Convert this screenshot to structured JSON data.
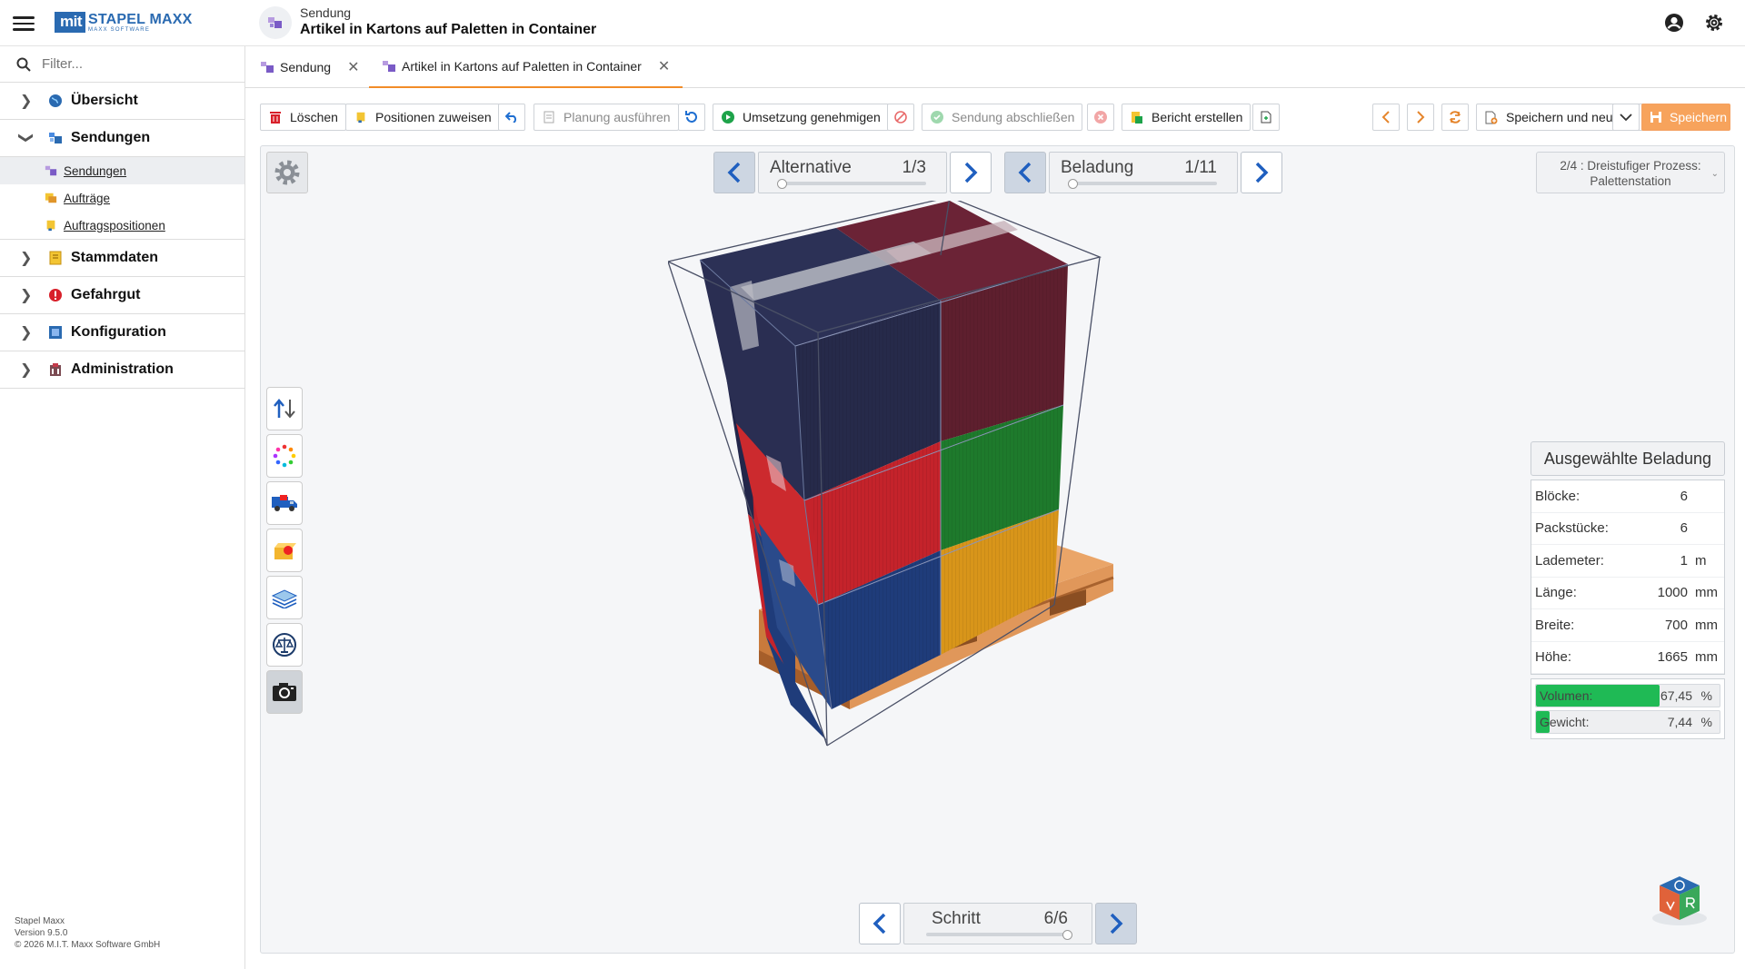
{
  "header": {
    "logo_box": "mit",
    "logo_main": "STAPEL MAXX",
    "logo_sub": "MAXX SOFTWARE",
    "kicker": "Sendung",
    "title": "Artikel in Kartons auf Paletten in Container",
    "icons": [
      "menu-icon",
      "user-icon",
      "gear-icon"
    ]
  },
  "sidebar": {
    "filter_placeholder": "Filter...",
    "items": [
      {
        "label": "Übersicht",
        "icon": "globe-icon",
        "expanded": false
      },
      {
        "label": "Sendungen",
        "icon": "shipment-icon",
        "expanded": true,
        "children": [
          {
            "label": "Sendungen",
            "icon": "shipment-icon",
            "active": true
          },
          {
            "label": "Aufträge",
            "icon": "order-icon",
            "active": false
          },
          {
            "label": "Auftragspositionen",
            "icon": "order-position-icon",
            "active": false
          }
        ]
      },
      {
        "label": "Stammdaten",
        "icon": "master-data-icon",
        "expanded": false
      },
      {
        "label": "Gefahrgut",
        "icon": "hazard-icon",
        "expanded": false
      },
      {
        "label": "Konfiguration",
        "icon": "config-icon",
        "expanded": false
      },
      {
        "label": "Administration",
        "icon": "admin-icon",
        "expanded": false
      }
    ],
    "footer": {
      "product": "Stapel Maxx",
      "version": "Version 9.5.0",
      "copyright": "© 2026 M.I.T. Maxx Software GmbH"
    }
  },
  "tabs": [
    {
      "label": "Sendung",
      "active": false
    },
    {
      "label": "Artikel in Kartons auf Paletten in Container",
      "active": true
    }
  ],
  "toolbar": {
    "delete": "Löschen",
    "assign_positions": "Positionen zuweisen",
    "run_planning": "Planung ausführen",
    "approve": "Umsetzung genehmigen",
    "close_shipment": "Sendung abschließen",
    "create_report": "Bericht erstellen",
    "save_and_new": "Speichern und neu",
    "save": "Speichern"
  },
  "viewer": {
    "alternative": {
      "label": "Alternative",
      "value": "1/3"
    },
    "loading": {
      "label": "Beladung",
      "value": "1/11"
    },
    "step": {
      "label": "Schritt",
      "value": "6/6"
    },
    "process": {
      "line1": "2/4 : Dreistufiger Prozess:",
      "line2": "Palettenstation"
    },
    "tools": [
      "sort-arrows-icon",
      "color-dots-icon",
      "truck-icon",
      "open-box-icon",
      "pallet-layers-icon",
      "scale-icon",
      "camera-icon"
    ]
  },
  "info": {
    "title": "Ausgewählte Beladung",
    "rows": [
      {
        "label": "Blöcke:",
        "value": "6",
        "unit": ""
      },
      {
        "label": "Packstücke:",
        "value": "6",
        "unit": ""
      },
      {
        "label": "Lademeter:",
        "value": "1",
        "unit": "m"
      },
      {
        "label": "Länge:",
        "value": "1000",
        "unit": "mm"
      },
      {
        "label": "Breite:",
        "value": "700",
        "unit": "mm"
      },
      {
        "label": "Höhe:",
        "value": "1665",
        "unit": "mm"
      }
    ],
    "volume": {
      "label": "Volumen:",
      "value": "67,45",
      "unit": "%",
      "fraction": 0.6745
    },
    "weight": {
      "label": "Gewicht:",
      "value": "7,44",
      "unit": "%",
      "fraction": 0.0744
    }
  },
  "colors": {
    "accent_orange": "#f28c28",
    "brand_blue": "#2a6ab1",
    "progress_green": "#1fba55",
    "box_navy": "#262a4a",
    "box_maroon": "#5e1f2e",
    "box_red": "#c4232b",
    "box_green": "#1e7a2c",
    "box_blue": "#1f3c7a",
    "box_yellow": "#d8951a",
    "pallet_wood": "#e0975a"
  }
}
